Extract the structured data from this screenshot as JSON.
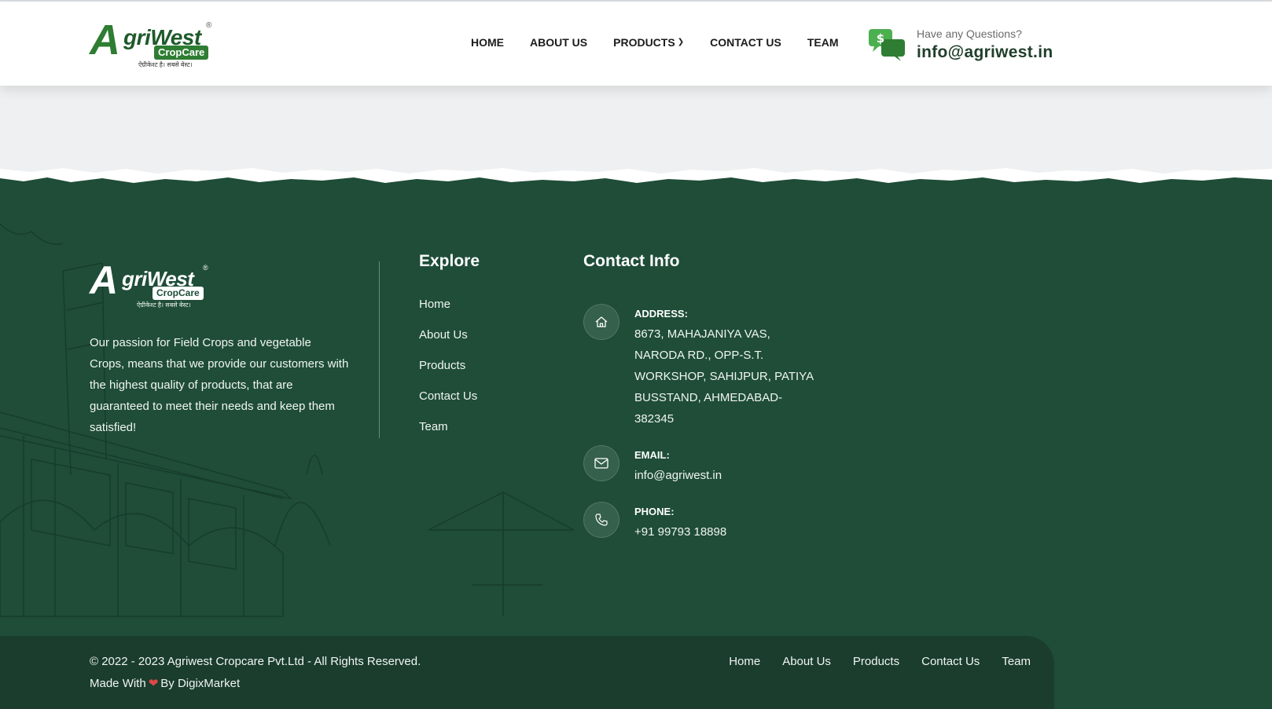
{
  "header": {
    "logo": {
      "brand": "AgriWest",
      "sub": "CropCare",
      "tagline": "ऐग्रीकेश्ट है। सबसे बेस्ट।",
      "reg": "®"
    },
    "nav": [
      {
        "label": "HOME"
      },
      {
        "label": "ABOUT US"
      },
      {
        "label": "PRODUCTS",
        "has_dropdown": true
      },
      {
        "label": "CONTACT US"
      },
      {
        "label": "TEAM"
      }
    ],
    "question_label": "Have any Questions?",
    "question_email": "info@agriwest.in",
    "icon": "chat-dollar-icon"
  },
  "footer": {
    "logo": {
      "brand": "AgriWest",
      "sub": "CropCare",
      "tagline": "ऐग्रीकेश्ट है। सबसे बेस्ट।",
      "reg": "®"
    },
    "about": "Our passion for Field Crops and vegetable Crops, means that we provide our customers with the highest quality of products, that are guaranteed to meet their needs and keep them satisfied!",
    "explore": {
      "title": "Explore",
      "items": [
        "Home",
        "About Us",
        "Products",
        "Contact Us",
        "Team"
      ]
    },
    "contact": {
      "title": "Contact Info",
      "address_label": "ADDRESS:",
      "address_lines": [
        "8673, MAHAJANIYA VAS,",
        "NARODA RD., OPP-S.T.",
        "WORKSHOP, SAHIJPUR, PATIYA",
        "BUSSTAND, AHMEDABAD-",
        "382345"
      ],
      "email_label": "EMAIL:",
      "email": "info@agriwest.in",
      "phone_label": "PHONE:",
      "phone": "+91 99793 18898"
    },
    "bottom": {
      "copyright": "© 2022 - 2023 Agriwest Cropcare Pvt.Ltd - All Rights Reserved.",
      "made_prefix": "Made With",
      "made_suffix": "By DigixMarket",
      "links": [
        "Home",
        "About Us",
        "Products",
        "Contact Us",
        "Team"
      ]
    }
  },
  "colors": {
    "brand_green": "#2e7d32",
    "footer_bg": "#1f4d38",
    "bottom_bar": "#1a3d2d",
    "heart": "#e04848"
  }
}
